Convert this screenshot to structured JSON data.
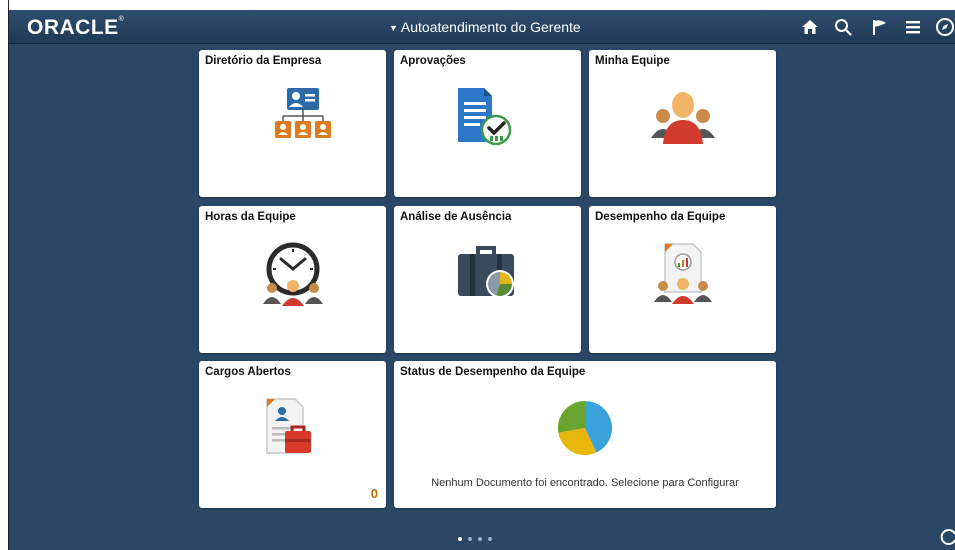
{
  "header": {
    "logo": "ORACLE",
    "logo_mark": "®",
    "nav_title": "Autoatendimento do Gerente",
    "nav_caret": "▼"
  },
  "header_icons": [
    "home-icon",
    "search-icon",
    "flag-icon",
    "menu-icon",
    "compass-icon"
  ],
  "tiles": [
    {
      "title": "Diretório da Empresa",
      "icon": "org-chart-icon"
    },
    {
      "title": "Aprovações",
      "icon": "approval-document-icon"
    },
    {
      "title": "Minha Equipe",
      "icon": "team-icon"
    },
    {
      "title": "Horas da Equipe",
      "icon": "clock-team-icon"
    },
    {
      "title": "Análise de Ausência",
      "icon": "briefcase-chart-icon"
    },
    {
      "title": "Desempenho da Equipe",
      "icon": "performance-document-icon"
    },
    {
      "title": "Cargos Abertos",
      "icon": "job-opening-icon",
      "count": "0"
    },
    {
      "title": "Status de Desempenho da Equipe",
      "icon": "pie-chart-icon",
      "message": "Nenhum Documento foi encontrado. Selecione para Configurar"
    }
  ],
  "pagination": {
    "pages": 4,
    "current": 1
  },
  "colors": {
    "page_background": "#2a4866",
    "header_background": "#2f4e6d",
    "count_color": "#c26a10"
  }
}
